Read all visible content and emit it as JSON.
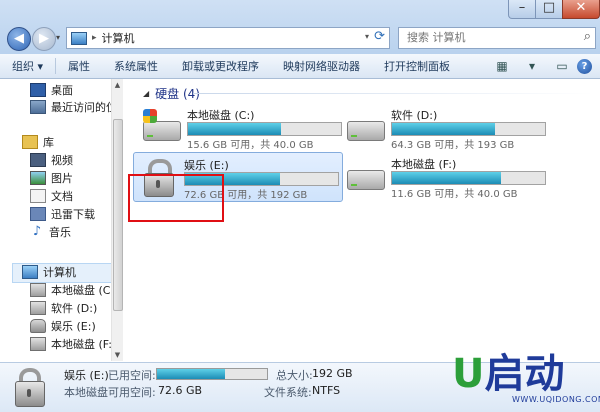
{
  "window": {
    "close_glyph": "✕",
    "max_glyph": "□",
    "min_glyph": "–"
  },
  "address": {
    "crumb": "计算机",
    "separator": "▸"
  },
  "search": {
    "placeholder": "搜索 计算机"
  },
  "toolbar": {
    "items": [
      "组织 ▾",
      "属性",
      "系统属性",
      "卸载或更改程序",
      "映射网络驱动器",
      "打开控制面板"
    ],
    "help": "?"
  },
  "sidebar": {
    "items": [
      {
        "label": "桌面",
        "icon": "desktop-icon"
      },
      {
        "label": "最近访问的位置",
        "icon": "recent-places-icon"
      },
      {
        "label": "库",
        "icon": "libraries-icon"
      },
      {
        "label": "视频",
        "icon": "video-icon"
      },
      {
        "label": "图片",
        "icon": "pictures-icon"
      },
      {
        "label": "文档",
        "icon": "documents-icon"
      },
      {
        "label": "迅雷下载",
        "icon": "folder-icon"
      },
      {
        "label": "音乐",
        "icon": "music-icon"
      },
      {
        "label": "计算机",
        "icon": "computer-icon"
      },
      {
        "label": "本地磁盘 (C:)",
        "icon": "windows-drive-icon"
      },
      {
        "label": "软件 (D:)",
        "icon": "drive-icon"
      },
      {
        "label": "娱乐 (E:)",
        "icon": "locked-drive-icon"
      },
      {
        "label": "本地磁盘 (F:)",
        "icon": "drive-icon"
      }
    ]
  },
  "main": {
    "group_title": "硬盘 (4)",
    "drives": [
      {
        "name": "本地磁盘 (C:)",
        "space": "15.6 GB 可用，共 40.0 GB",
        "used_fraction": 0.61,
        "icon": "windows-drive-icon"
      },
      {
        "name": "软件 (D:)",
        "space": "64.3 GB 可用，共 193 GB",
        "used_fraction": 0.67,
        "icon": "drive-icon"
      },
      {
        "name": "娱乐 (E:)",
        "space": "72.6 GB 可用，共 192 GB",
        "used_fraction": 0.62,
        "icon": "locked-drive-icon"
      },
      {
        "name": "本地磁盘 (F:)",
        "space": "11.6 GB 可用，共 40.0 GB",
        "used_fraction": 0.71,
        "icon": "drive-icon"
      }
    ]
  },
  "details": {
    "name": "娱乐 (E:)",
    "type": "本地磁盘",
    "used_label": "已用空间:",
    "free_label": "可用空间:",
    "free_value": "72.6 GB",
    "total_label": "总大小:",
    "total_value": "192 GB",
    "fs_label": "文件系统:",
    "fs_value": "NTFS",
    "used_fraction": 0.62
  },
  "logo": {
    "u": "U",
    "text": "启动",
    "url": "WWW.UQIDONG.COM"
  }
}
